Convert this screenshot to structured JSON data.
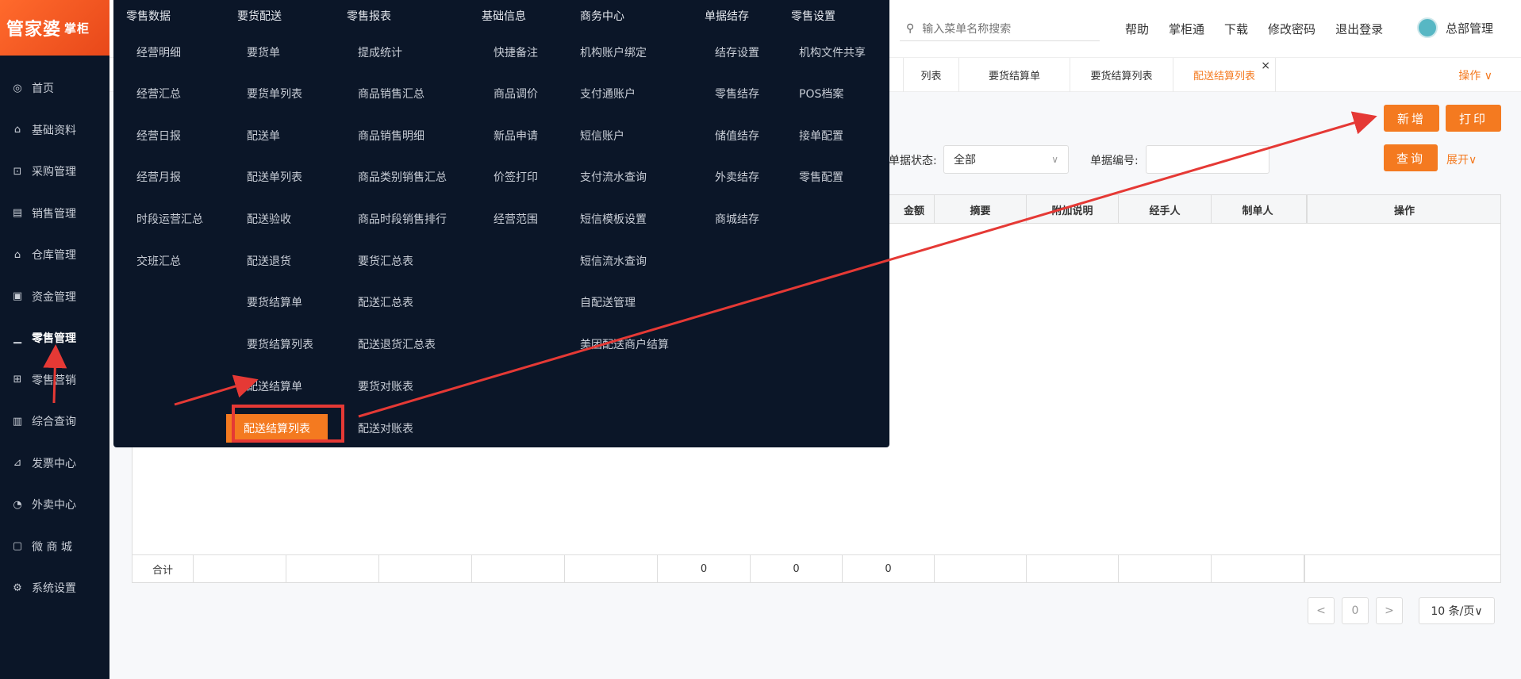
{
  "app": {
    "logo_text": "管家婆",
    "logo_sub": "掌柜"
  },
  "sidebar": {
    "items": [
      {
        "label": "首页",
        "icon": "globe-icon",
        "glyph": "◎"
      },
      {
        "label": "基础资料",
        "icon": "home-icon",
        "glyph": "⌂"
      },
      {
        "label": "采购管理",
        "icon": "cart-icon",
        "glyph": "⊡"
      },
      {
        "label": "销售管理",
        "icon": "keyboard-icon",
        "glyph": "▤"
      },
      {
        "label": "仓库管理",
        "icon": "bank-icon",
        "glyph": "⌂"
      },
      {
        "label": "资金管理",
        "icon": "wallet-icon",
        "glyph": "▣"
      },
      {
        "label": "零售管理",
        "icon": "chart-icon",
        "glyph": "▁"
      },
      {
        "label": "零售营销",
        "icon": "gift-icon",
        "glyph": "⊞"
      },
      {
        "label": "综合查询",
        "icon": "bar-chart-icon",
        "glyph": "▥"
      },
      {
        "label": "发票中心",
        "icon": "trend-icon",
        "glyph": "⊿"
      },
      {
        "label": "外卖中心",
        "icon": "alarm-icon",
        "glyph": "◔"
      },
      {
        "label": "微 商 城",
        "icon": "bag-icon",
        "glyph": "▢"
      },
      {
        "label": "系统设置",
        "icon": "gear-icon",
        "glyph": "⚙"
      }
    ]
  },
  "topbar": {
    "search_placeholder": "输入菜单名称搜索",
    "links": [
      "帮助",
      "掌柜通",
      "下载",
      "修改密码",
      "退出登录"
    ],
    "user": "总部管理"
  },
  "tabs": {
    "items": [
      "列表",
      "要货结算单",
      "要货结算列表",
      "配送结算列表"
    ],
    "close": "×",
    "ops": "操作 ∨"
  },
  "toolbar": {
    "add": "新增",
    "print": "打印",
    "query": "查询",
    "expand": "展开∨"
  },
  "filters": {
    "status_label": "单据状态:",
    "status_value": "全部",
    "number_label": "单据编号:"
  },
  "table": {
    "headers": [
      "金额",
      "摘要",
      "附加说明",
      "经手人",
      "制单人",
      "操作"
    ],
    "footer_label": "合计",
    "footer_values": [
      "0",
      "0",
      "0"
    ]
  },
  "pager": {
    "page": "0",
    "size": "10 条/页∨",
    "prev": "<",
    "next": ">"
  },
  "mega": {
    "cols": [
      {
        "head": "零售数据",
        "items": [
          "经营明细",
          "经营汇总",
          "经营日报",
          "经营月报",
          "时段运营汇总",
          "交班汇总"
        ]
      },
      {
        "head": "要货配送",
        "items": [
          "要货单",
          "要货单列表",
          "配送单",
          "配送单列表",
          "配送验收",
          "配送退货",
          "要货结算单",
          "要货结算列表",
          "配送结算单",
          "配送结算列表"
        ]
      },
      {
        "head": "零售报表",
        "items": [
          "提成统计",
          "商品销售汇总",
          "商品销售明细",
          "商品类别销售汇总",
          "商品时段销售排行",
          "要货汇总表",
          "配送汇总表",
          "配送退货汇总表",
          "要货对账表",
          "配送对账表"
        ]
      },
      {
        "head": "基础信息",
        "items": [
          "快捷备注",
          "商品调价",
          "新品申请",
          "价签打印",
          "经营范围"
        ]
      },
      {
        "head": "商务中心",
        "items": [
          "机构账户绑定",
          "支付通账户",
          "短信账户",
          "支付流水查询",
          "短信模板设置",
          "短信流水查询",
          "自配送管理",
          "美团配送商户结算"
        ]
      },
      {
        "head": "单据结存",
        "items": [
          "结存设置",
          "零售结存",
          "储值结存",
          "外卖结存",
          "商城结存"
        ]
      },
      {
        "head": "零售设置",
        "items": [
          "机构文件共享",
          "POS档案",
          "接单配置",
          "零售配置"
        ]
      }
    ]
  },
  "colors": {
    "accent": "#f47a20",
    "sidebar": "#0b1628",
    "annotation": "#e53935"
  }
}
